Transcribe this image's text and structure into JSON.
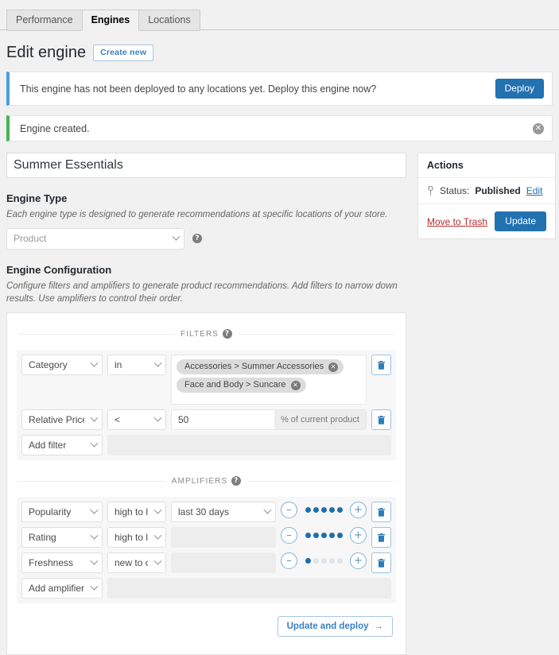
{
  "tabs": [
    {
      "label": "Performance",
      "active": false
    },
    {
      "label": "Engines",
      "active": true
    },
    {
      "label": "Locations",
      "active": false
    }
  ],
  "header": {
    "title": "Edit engine",
    "create_new_label": "Create new"
  },
  "notices": [
    {
      "type": "info",
      "text": "This engine has not been deployed to any locations yet. Deploy this engine now?",
      "button_label": "Deploy",
      "accent": "#4a9edc"
    },
    {
      "type": "success",
      "text": "Engine created.",
      "dismiss_icon": "close-icon",
      "accent": "#46b450"
    }
  ],
  "engine": {
    "title_value": "Summer Essentials"
  },
  "engine_type": {
    "heading": "Engine Type",
    "description": "Each engine type is designed to generate recommendations at specific locations of your store.",
    "selected": "Product",
    "help_icon": "help-icon"
  },
  "engine_config": {
    "heading": "Engine Configuration",
    "description": "Configure filters and amplifiers to generate product recommendations. Add filters to narrow down results. Use amplifiers to control their order."
  },
  "filters": {
    "section_label": "FILTERS",
    "help_icon": "help-icon",
    "rows": [
      {
        "type": "Category",
        "operator": "in",
        "value_kind": "chips",
        "chips": [
          "Accessories > Summer Accessories",
          "Face and Body > Suncare"
        ],
        "delete_icon": "trash-icon"
      },
      {
        "type": "Relative Price",
        "operator": "<",
        "value_kind": "number",
        "value": "50",
        "suffix": "% of current product",
        "delete_icon": "trash-icon"
      }
    ],
    "add_label": "Add filter"
  },
  "amplifiers": {
    "section_label": "AMPLIFIERS",
    "help_icon": "help-icon",
    "max_strength": 5,
    "decrement_label": "–",
    "increment_label": "+",
    "rows": [
      {
        "type": "Popularity",
        "order": "high to low",
        "range": "last 30 days",
        "range_kind": "select",
        "strength": 5,
        "delete_icon": "trash-icon"
      },
      {
        "type": "Rating",
        "order": "high to low",
        "range": "",
        "range_kind": "disabled",
        "strength": 5,
        "delete_icon": "trash-icon"
      },
      {
        "type": "Freshness",
        "order": "new to old",
        "range": "",
        "range_kind": "disabled",
        "strength": 1,
        "delete_icon": "trash-icon"
      }
    ],
    "add_label": "Add amplifier"
  },
  "panel_footer": {
    "update_deploy_label": "Update and deploy",
    "arrow_icon": "arrow-right-icon"
  },
  "actions": {
    "heading": "Actions",
    "status_icon": "pin-icon",
    "status_prefix": "Status:",
    "status_value": "Published",
    "status_edit_label": "Edit",
    "trash_label": "Move to Trash",
    "update_label": "Update"
  },
  "colors": {
    "primary_blue": "#2271b1",
    "link_blue": "#3a7fbf",
    "danger_red": "#b32d2e",
    "success_green": "#46b450",
    "info_blue": "#4a9edc",
    "dot_active": "#1f6fab",
    "dot_inactive": "#dfe4e8"
  }
}
